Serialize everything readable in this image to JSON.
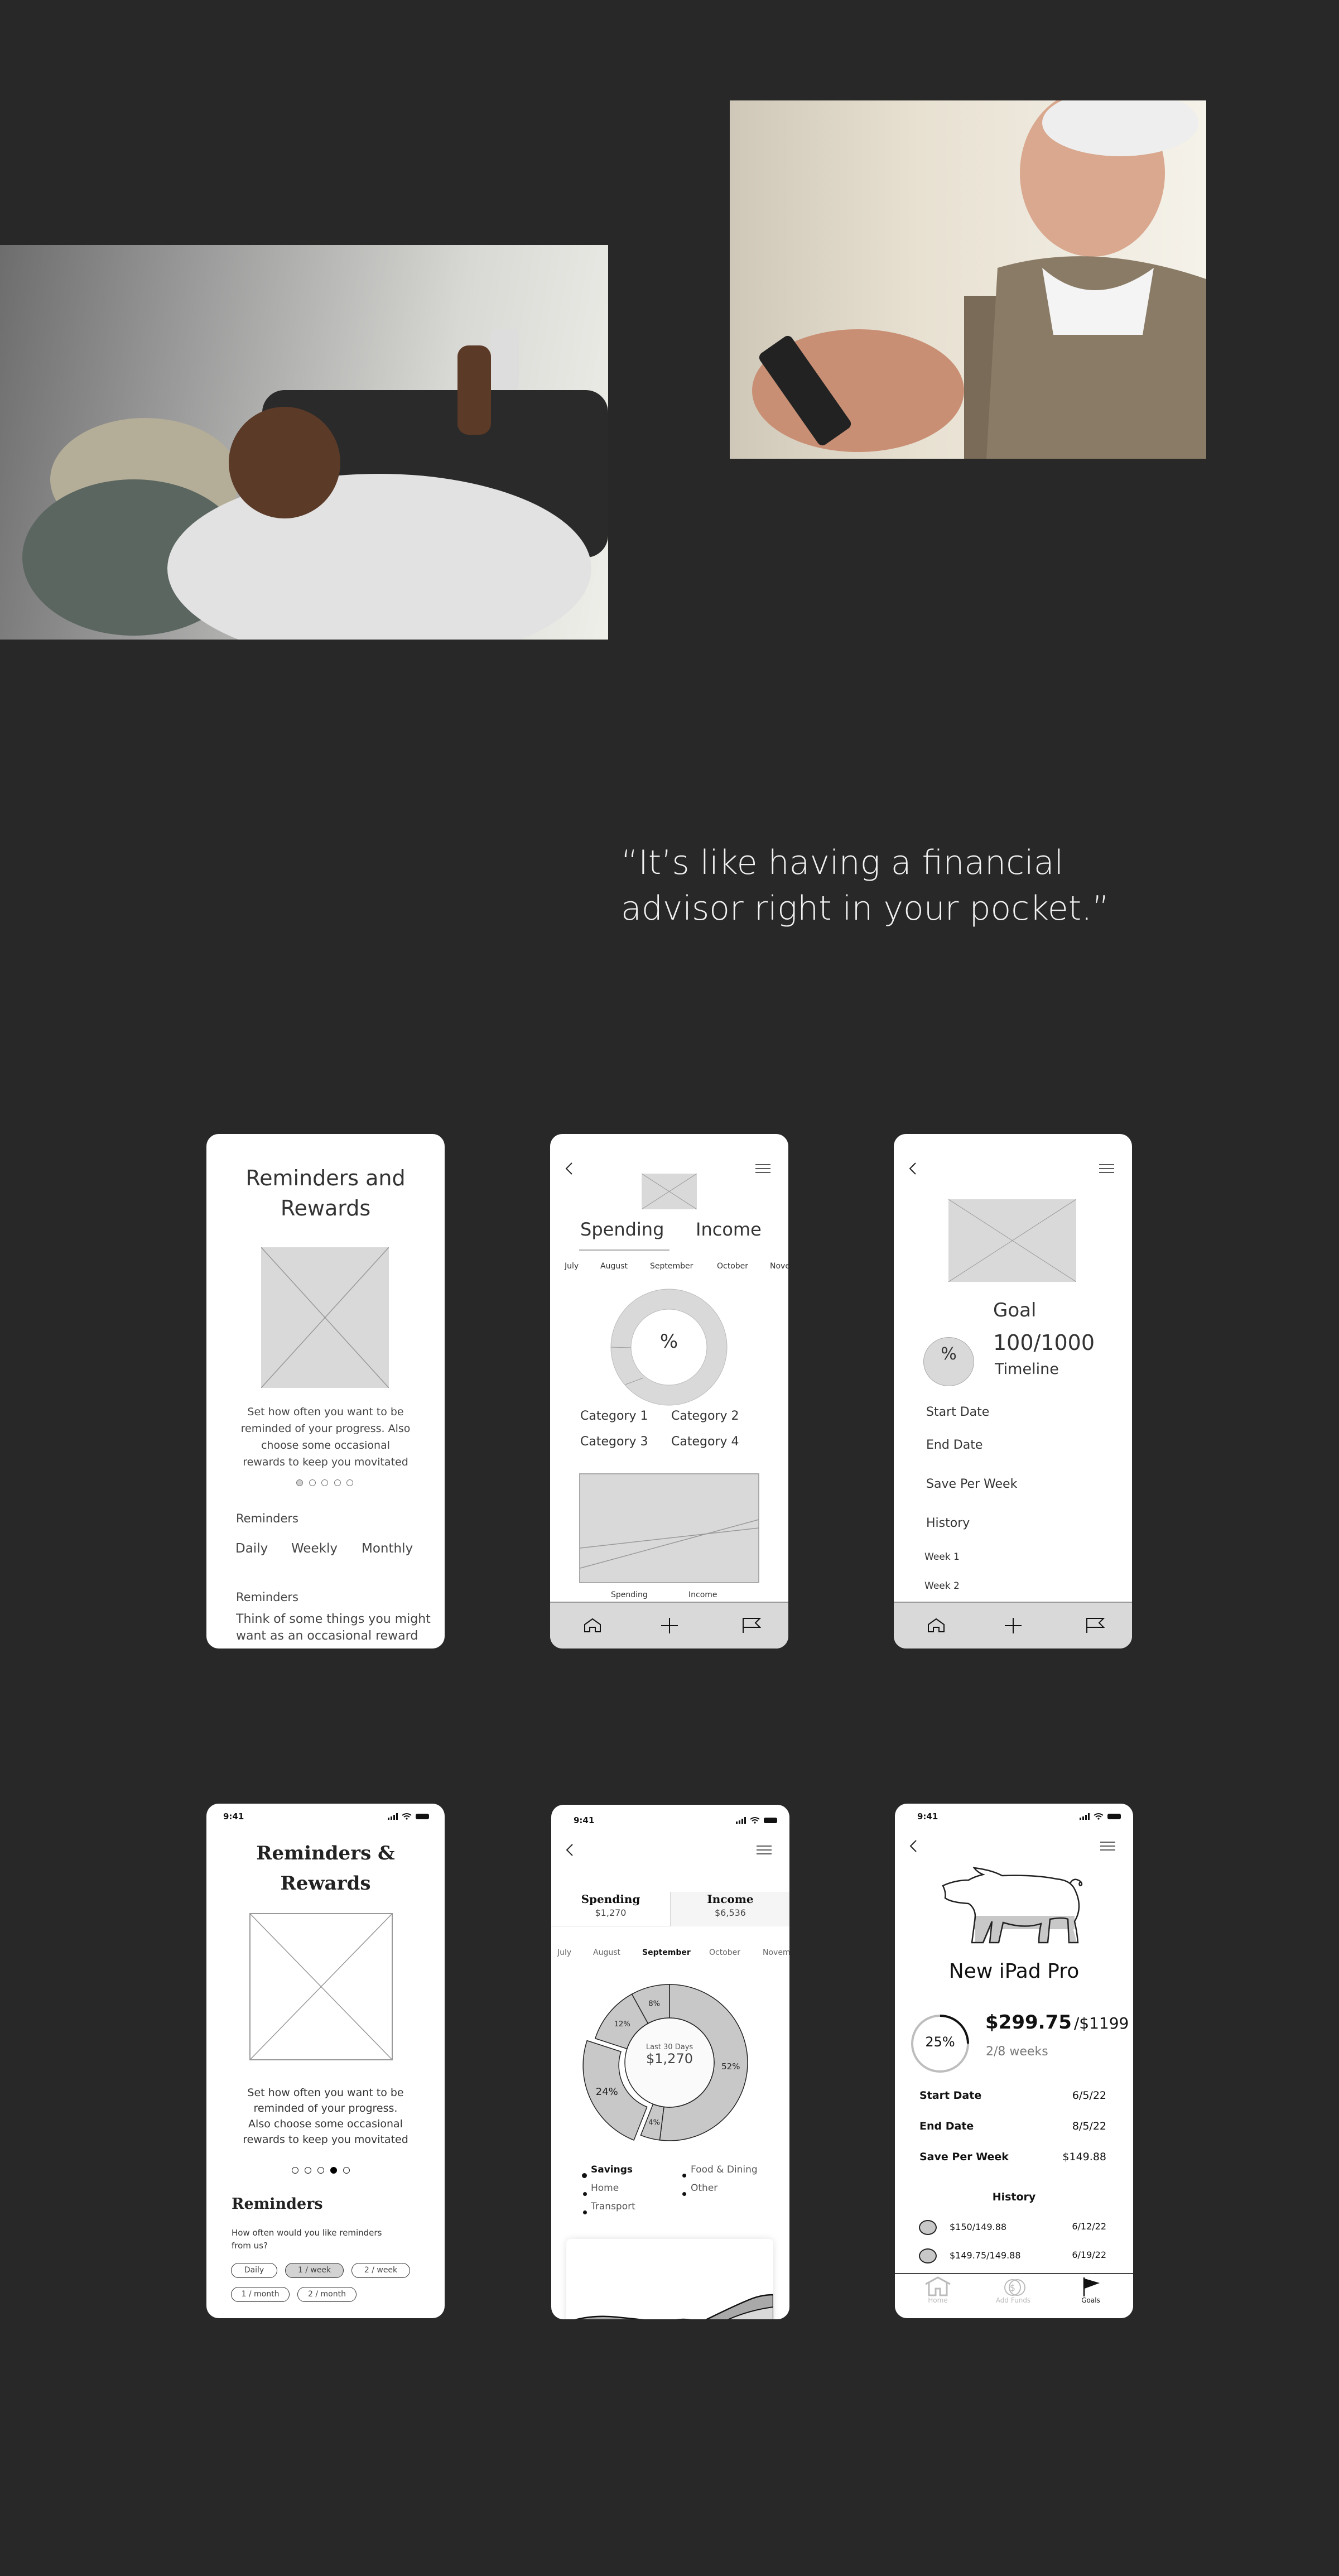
{
  "quote": {
    "line1": "“It’s like having a financial",
    "line2": "advisor right in your pocket.”"
  },
  "photos": [
    {
      "subject": "man-on-couch-using-phone"
    },
    {
      "subject": "older-man-using-phone"
    }
  ],
  "lofi_reminders": {
    "title_line1": "Reminders and",
    "title_line2": "Rewards",
    "description": [
      "Set how often you want to be",
      "reminded of your progress. Also",
      "choose some occasional",
      "rewards to keep you movitated"
    ],
    "pager_active": 1,
    "reminders_label": "Reminders",
    "frequency_options": [
      "Daily",
      "Weekly",
      "Monthly"
    ],
    "rewards_label": "Reminders",
    "rewards_text": [
      "Think of some things you might",
      "want as an occasional reward"
    ]
  },
  "lofi_spending": {
    "tabs": [
      "Spending",
      "Income"
    ],
    "months": [
      "July",
      "August",
      "September",
      "October",
      "Nove"
    ],
    "donut_center": "%",
    "categories": [
      "Category 1",
      "Category 2",
      "Category 3",
      "Category 4"
    ],
    "chart_labels": [
      "Spending",
      "Income"
    ]
  },
  "lofi_goal": {
    "goal_label": "Goal",
    "progress": "100/1000",
    "timeline_label": "Timeline",
    "percent_symbol": "%",
    "rows": [
      "Start Date",
      "End Date",
      "Save Per Week",
      "History"
    ],
    "history": [
      "Week 1",
      "Week 2"
    ]
  },
  "hifi_reminders": {
    "status_time": "9:41",
    "title_line1": "Reminders &",
    "title_line2": "Rewards",
    "description": [
      "Set how often you want to be",
      "reminded of your progress.",
      "Also choose some occasional",
      "rewards to keep you movitated"
    ],
    "pager_active": 4,
    "section_title": "Reminders",
    "question": [
      "How often would you like reminders",
      "from us?"
    ],
    "chips": [
      {
        "label": "Daily",
        "selected": false
      },
      {
        "label": "1 / week",
        "selected": true
      },
      {
        "label": "2 / week",
        "selected": false
      },
      {
        "label": "1 / month",
        "selected": false
      },
      {
        "label": "2 / month",
        "selected": false
      }
    ]
  },
  "hifi_spending": {
    "status_time": "9:41",
    "tabs": [
      {
        "label": "Spending",
        "amount": "$1,270"
      },
      {
        "label": "Income",
        "amount": "$6,536"
      }
    ],
    "months": [
      "July",
      "August",
      "September",
      "October",
      "Novem"
    ],
    "selected_month": "September",
    "donut": {
      "center_label": "Last 30 Days",
      "center_value": "$1,270",
      "segments": [
        {
          "label": "52%",
          "value": 52,
          "exploded": false
        },
        {
          "label": "4%",
          "value": 4,
          "exploded": false
        },
        {
          "label": "24%",
          "value": 24,
          "exploded": true
        },
        {
          "label": "12%",
          "value": 12,
          "exploded": false
        },
        {
          "label": "8%",
          "value": 8,
          "exploded": false
        }
      ],
      "fill": "#c8c8c8"
    },
    "legend": [
      "Savings",
      "Home",
      "Transport",
      "Food & Dining",
      "Other"
    ]
  },
  "hifi_goal": {
    "status_time": "9:41",
    "goal_name": "New iPad Pro",
    "percent": "25%",
    "percent_value": 25,
    "saved": "$299.75",
    "target": "/$1199",
    "weeks": "2/8 weeks",
    "details": [
      {
        "label": "Start Date",
        "value": "6/5/22"
      },
      {
        "label": "End Date",
        "value": "8/5/22"
      },
      {
        "label": "Save Per Week",
        "value": "$149.88"
      }
    ],
    "history_title": "History",
    "history": [
      {
        "amount": "$150/149.88",
        "date": "6/12/22"
      },
      {
        "amount": "$149.75/149.88",
        "date": "6/19/22"
      }
    ],
    "nav": [
      {
        "label": "Home",
        "active": false
      },
      {
        "label": "Add Funds",
        "active": false
      },
      {
        "label": "Goals",
        "active": true
      }
    ]
  }
}
